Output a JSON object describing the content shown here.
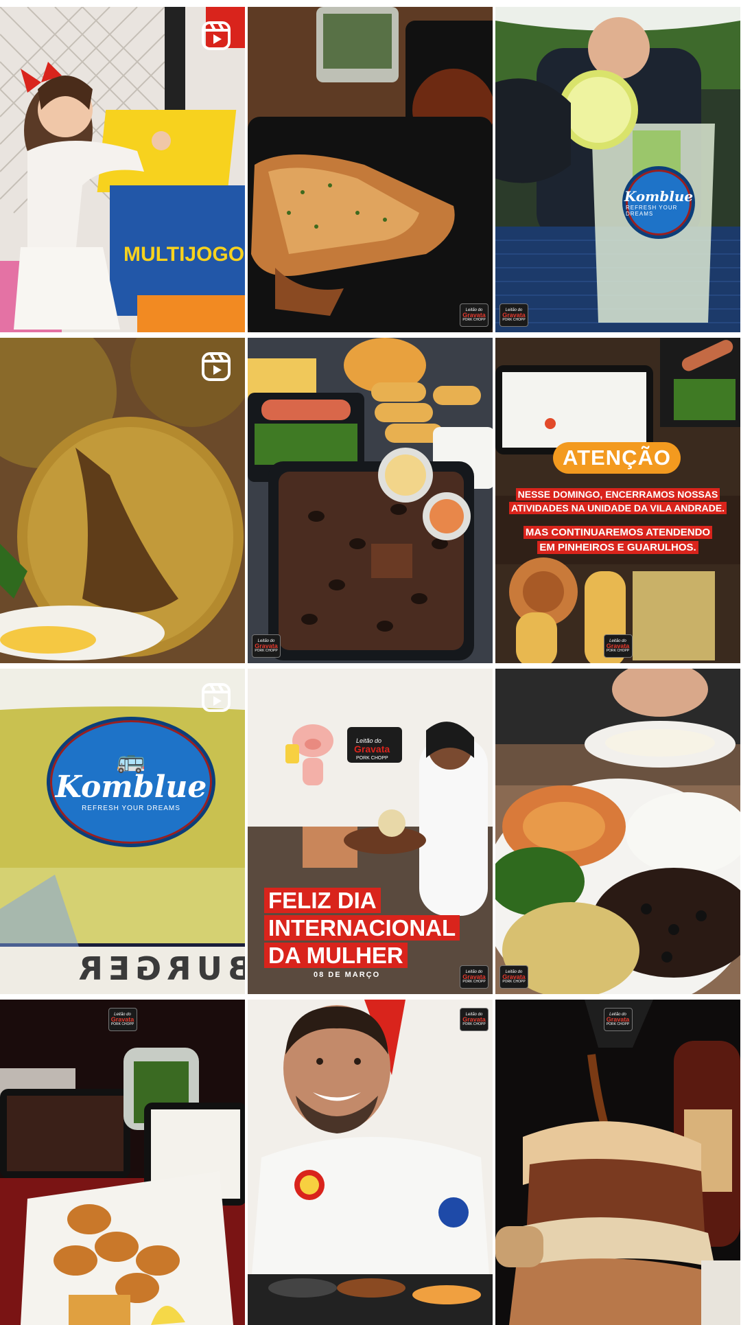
{
  "grid": {
    "tiles": [
      {
        "id": 1,
        "reel": true
      },
      {
        "id": 2,
        "reel": false
      },
      {
        "id": 3,
        "reel": false
      },
      {
        "id": 4,
        "reel": true
      },
      {
        "id": 5,
        "reel": false
      },
      {
        "id": 6,
        "reel": false
      },
      {
        "id": 7,
        "reel": true
      },
      {
        "id": 8,
        "reel": false
      },
      {
        "id": 9,
        "reel": false
      },
      {
        "id": 10,
        "reel": false
      },
      {
        "id": 11,
        "reel": false
      },
      {
        "id": 12,
        "reel": false
      }
    ]
  },
  "icons": {
    "reel": "reels-play-icon"
  },
  "watermark": {
    "line1": "Leitão do",
    "line2": "Gravata",
    "line3": "PORK CHOPP"
  },
  "tile1": {
    "arcade_text": "MULTIJOGOS KIDS"
  },
  "tile3": {
    "brand": "Komblue",
    "tagline": "REFRESH YOUR DREAMS"
  },
  "tile6": {
    "badge": "ATENÇÃO",
    "line1": "NESSE DOMINGO, ENCERRAMOS NOSSAS",
    "line2": "ATIVIDADES NA UNIDADE DA VILA ANDRADE.",
    "line3": "MAS CONTINUAREMOS ATENDENDO",
    "line4": "EM PINHEIROS E GUARULHOS."
  },
  "tile7": {
    "brand": "Komblue",
    "tagline": "REFRESH YOUR DREAMS",
    "floor_text": "BURGER"
  },
  "tile8": {
    "line1": "FELIZ DIA",
    "line2": "INTERNACIONAL",
    "line3": "DA MULHER",
    "date": "08 DE MARÇO"
  },
  "colors": {
    "accent_red": "#d9241c",
    "accent_orange": "#f39a1f",
    "komblue_blue": "#1e73c8"
  }
}
